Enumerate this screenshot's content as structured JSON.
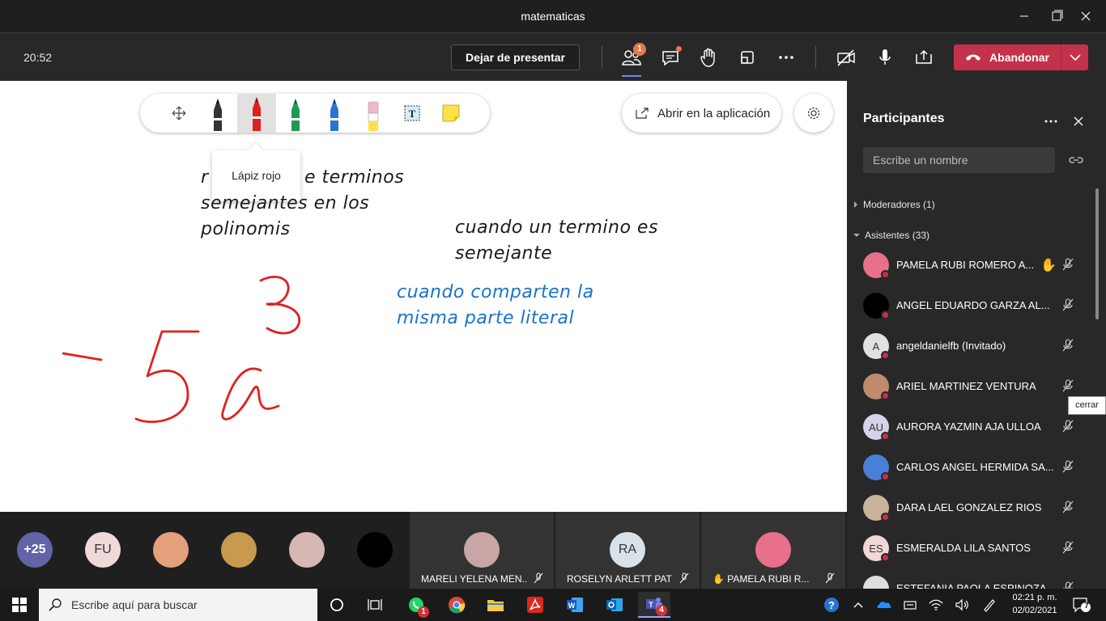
{
  "window": {
    "title": "matematicas"
  },
  "meeting": {
    "clock": "20:52",
    "stop_presenting_label": "Dejar de presentar",
    "participants_badge": "1",
    "leave_label": "Abandonar"
  },
  "whiteboard": {
    "tooltip": "Lápiz rojo",
    "open_app_label": "Abrir en la aplicación",
    "tools": [
      "move",
      "black-pen",
      "red-pen",
      "green-pen",
      "blue-pen",
      "highlighter",
      "text",
      "sticky-note"
    ],
    "handwriting": {
      "line1a": "r",
      "line1b": "e terminos",
      "line2": "semejantes en los",
      "line3": "polinomis",
      "line4": "cuando un termino es",
      "line5": "semejante",
      "blue1": "cuando comparten la",
      "blue2": "misma parte literal"
    },
    "ink_color": "#e0201f"
  },
  "gallery": {
    "overflow_count": "+25",
    "avatars": [
      {
        "initials": "FU",
        "color": "#f0d9d9"
      },
      {
        "initials": "",
        "color": "#e4a07a"
      },
      {
        "initials": "",
        "color": "#c79a4d"
      },
      {
        "initials": "",
        "color": "#d7b7b3"
      },
      {
        "initials": "",
        "color": "#000000"
      }
    ],
    "tiles": [
      {
        "name": "MARELI YELENA MEN...",
        "initials": "",
        "color": "#c8a6a6",
        "hand": ""
      },
      {
        "name": "ROSELYN ARLETT PATI...",
        "initials": "RA",
        "color": "#d8e2e8",
        "hand": ""
      },
      {
        "name": "PAMELA RUBI R...",
        "initials": "",
        "color": "#e9708a",
        "hand": "✋"
      }
    ]
  },
  "panel": {
    "title": "Participantes",
    "search_placeholder": "Escribe un nombre",
    "moderators": "Moderadores (1)",
    "attendees": "Asistentes (33)",
    "close_tooltip": "cerrar",
    "participants": [
      {
        "name": "PAMELA RUBI ROMERO A...",
        "initials": "",
        "color": "#e9708a",
        "hand": "✋"
      },
      {
        "name": "ANGEL EDUARDO GARZA AL...",
        "initials": "",
        "color": "#000000",
        "hand": ""
      },
      {
        "name": "angeldanielfb (Invitado)",
        "initials": "A",
        "color": "#e1e1e1",
        "hand": ""
      },
      {
        "name": "ARIEL MARTINEZ VENTURA",
        "initials": "",
        "color": "#c08a6c",
        "hand": ""
      },
      {
        "name": "AURORA YAZMIN AJA ULLOA",
        "initials": "AU",
        "color": "#d5d3ea",
        "hand": ""
      },
      {
        "name": "CARLOS ANGEL HERMIDA SA...",
        "initials": "",
        "color": "#4a7fd8",
        "hand": ""
      },
      {
        "name": "DARA LAEL GONZALEZ RIOS",
        "initials": "",
        "color": "#c9b39a",
        "hand": ""
      },
      {
        "name": "ESMERALDA LILA SANTOS",
        "initials": "ES",
        "color": "#f2d7d7",
        "hand": ""
      },
      {
        "name": "ESTEFANIA PAOLA ESPINOZA",
        "initials": "",
        "color": "#dddddd",
        "hand": ""
      }
    ]
  },
  "taskbar": {
    "search_placeholder": "Escribe aquí para buscar",
    "whatsapp_badge": "1",
    "teams_badge": "4",
    "time": "02:21 p. m.",
    "date": "02/02/2021",
    "notification_count": "7"
  }
}
